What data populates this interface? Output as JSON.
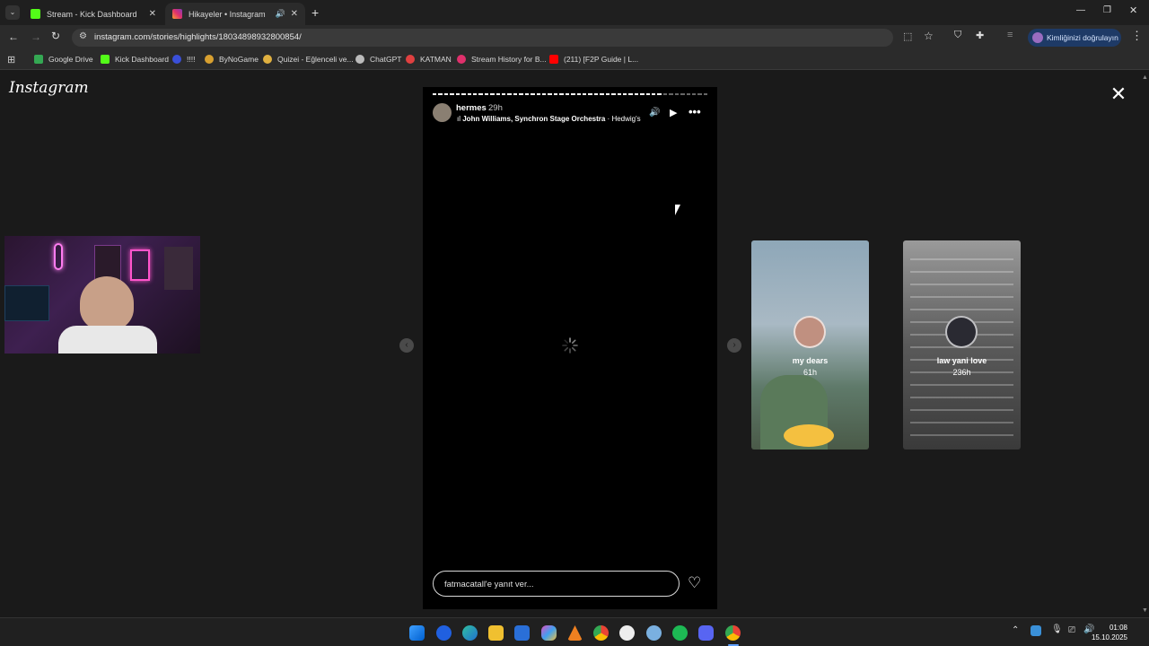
{
  "browser": {
    "tabs": [
      {
        "title": "Stream - Kick Dashboard",
        "active": false
      },
      {
        "title": "Hikayeler • Instagram",
        "active": true
      }
    ],
    "url": "instagram.com/stories/highlights/18034898932800854/",
    "profile_button": "Kimliğinizi doğrulayın",
    "bookmarks": [
      "Google Drive",
      "Kick Dashboard",
      "!!!!",
      "ByNoGame",
      "Quizei - Eğlenceli ve...",
      "ChatGPT",
      "KATMAN",
      "Stream History for B...",
      "(211) [F2P Guide | L..."
    ]
  },
  "instagram": {
    "logo": "Instagram",
    "story": {
      "username": "hermes",
      "time_ago": "29h",
      "music_artist": "John Williams, Synchron Stage Orchestra",
      "music_track": "Hedwig's Th",
      "reply_placeholder": "fatmacatall'e yanıt ver...",
      "progress_done": 40,
      "progress_total": 48
    },
    "highlights": [
      {
        "name": "my dears",
        "age": "61h"
      },
      {
        "name": "law yani love",
        "age": "236h"
      }
    ]
  },
  "taskbar": {
    "time": "01:08",
    "date": "15.10.2025"
  }
}
